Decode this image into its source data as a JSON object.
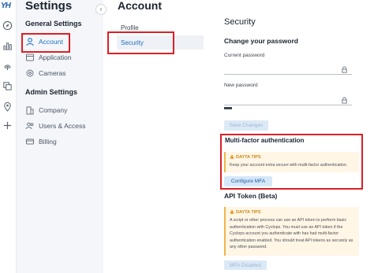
{
  "rail": {
    "logo": "YH",
    "icons": [
      "compass-icon",
      "bar-chart-icon",
      "fingerprint-icon",
      "layers-icon",
      "map-pin-icon",
      "plus-icon"
    ]
  },
  "settings": {
    "title": "Settings",
    "general_title": "General Settings",
    "general_items": [
      {
        "label": "Account",
        "icon": "user-icon",
        "active": true
      },
      {
        "label": "Application",
        "icon": "application-icon"
      },
      {
        "label": "Cameras",
        "icon": "camera-icon"
      }
    ],
    "admin_title": "Admin Settings",
    "admin_items": [
      {
        "label": "Company",
        "icon": "building-icon"
      },
      {
        "label": "Users & Access",
        "icon": "users-icon"
      },
      {
        "label": "Billing",
        "icon": "credit-card-icon"
      }
    ],
    "collapse_icon": "‹"
  },
  "account": {
    "title": "Account",
    "subnav": [
      {
        "label": "Profile"
      },
      {
        "label": "Security",
        "active": true
      }
    ]
  },
  "security": {
    "title": "Security",
    "change_password_title": "Change your password",
    "current_password_label": "Current password",
    "new_password_label": "New password",
    "save_changes_label": "Save Changes",
    "mfa": {
      "title": "Multi-factor authentication",
      "tip_head": "DAYTA TIPS",
      "tip_body": "Keep your account extra secure with multi-factor authentication.",
      "configure_label": "Configure MFA"
    },
    "api": {
      "title": "API Token (Beta)",
      "tip_head": "DAYTA TIPS",
      "tip_body": "A script or other process can use an API token to perform basic authentication with Cyclops. You must use an API token if the Cyclops account you authenticate with has had multi-factor authentication enabled. You should treat API tokens as securely as any other password.",
      "mfa_disabled_label": "MFA Disabled"
    }
  },
  "colors": {
    "accent": "#1d6fc7",
    "highlight": "#dc1f26",
    "tip_bg": "#fff6e6",
    "tip_accent": "#f0b44b"
  }
}
